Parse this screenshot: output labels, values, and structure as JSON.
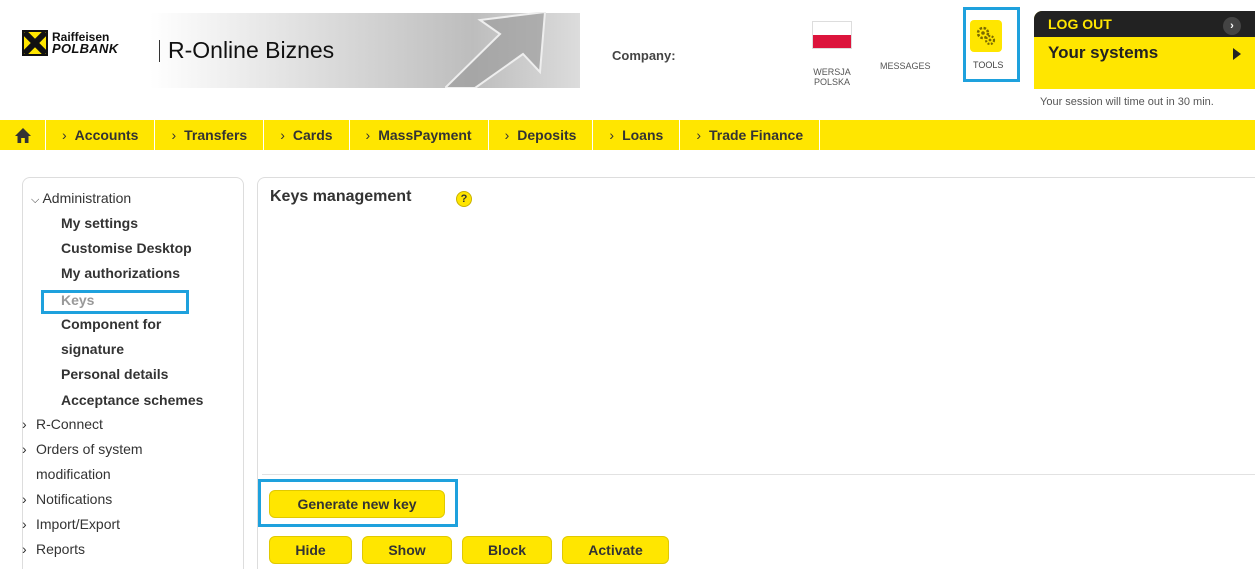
{
  "header": {
    "brand_line1": "Raiffeisen",
    "brand_line2": "POLBANK",
    "app_title": "R-Online Biznes",
    "company_label": "Company:",
    "language_label": "WERSJA POLSKA",
    "messages_label": "MESSAGES",
    "tools_label": "TOOLS",
    "logout_label": "LOG OUT",
    "systems_label": "Your systems",
    "session_notice": "Your session will time out in 30 min."
  },
  "nav": {
    "items": [
      "Accounts",
      "Transfers",
      "Cards",
      "MassPayment",
      "Deposits",
      "Loans",
      "Trade Finance"
    ]
  },
  "sidebar": {
    "administration": "Administration",
    "sub_items": [
      "My settings",
      "Customise Desktop",
      "My authorizations",
      "Keys",
      "Component for",
      "signature",
      "Personal details",
      "Acceptance schemes"
    ],
    "groups": [
      "R-Connect",
      "Orders of system",
      "modification",
      "Notifications",
      "Import/Export",
      "Reports"
    ]
  },
  "main": {
    "title": "Keys management",
    "help": "?",
    "generate_button": "Generate new key",
    "actions": [
      "Hide",
      "Show",
      "Block",
      "Activate"
    ]
  },
  "colors": {
    "accent": "#ffe600",
    "highlight": "#1ea1dd",
    "dark": "#222222"
  }
}
